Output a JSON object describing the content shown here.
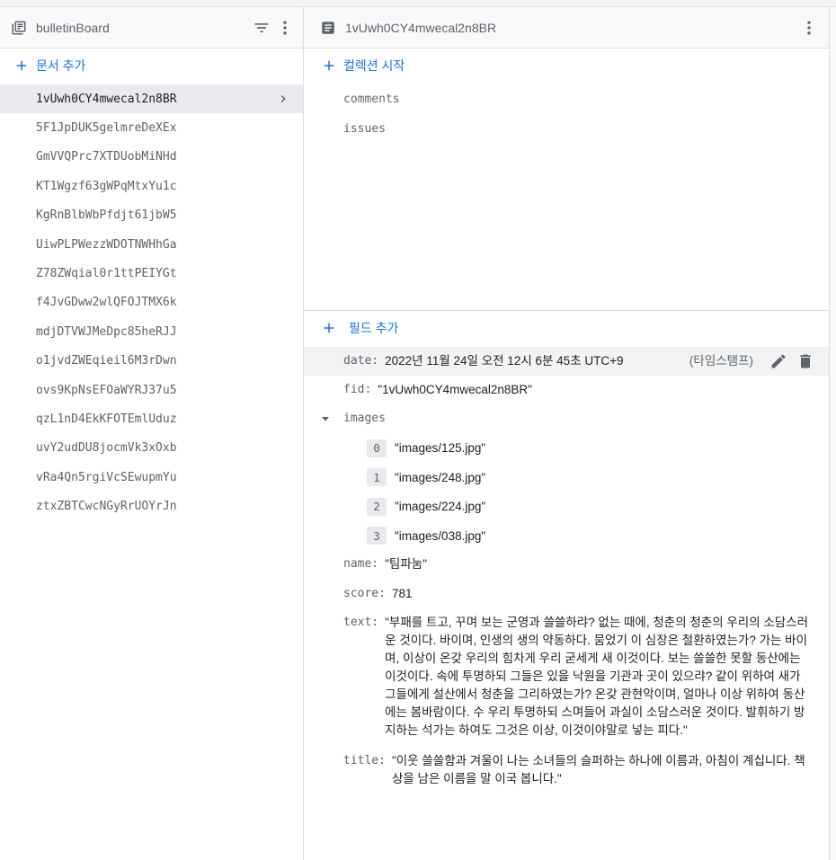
{
  "collection_panel": {
    "title": "bulletinBoard",
    "add_document_label": "문서 추가",
    "documents": [
      "1vUwh0CY4mwecal2n8BR",
      "5F1JpDUK5gelmreDeXEx",
      "GmVVQPrc7XTDUobMiNHd",
      "KT1Wgzf63gWPqMtxYu1c",
      "KgRnBlbWbPfdjt61jbW5",
      "UiwPLPWezzWDOTNWHhGa",
      "Z78ZWqial0r1ttPEIYGt",
      "f4JvGDww2wlQFOJTMX6k",
      "mdjDTVWJMeDpc85heRJJ",
      "o1jvdZWEqieil6M3rDwn",
      "ovs9KpNsEFOaWYRJ37u5",
      "qzL1nD4EkKFOTEmlUduz",
      "uvY2udDU8jocmVk3xOxb",
      "vRa4Qn5rgiVcSEwupmYu",
      "ztxZBTCwcNGyRrUOYrJn"
    ],
    "selected_index": 0
  },
  "document_panel": {
    "title": "1vUwh0CY4mwecal2n8BR",
    "start_collection_label": "컬렉션 시작",
    "subcollections": [
      "comments",
      "issues"
    ],
    "add_field_label": "필드 추가",
    "fields": {
      "date": {
        "key": "date:",
        "value": "2022년 11월 24일 오전 12시 6분 45초 UTC+9",
        "type": "(타임스탬프)"
      },
      "fid": {
        "key": "fid:",
        "value": "\"1vUwh0CY4mwecal2n8BR\""
      },
      "images": {
        "key": "images",
        "items": [
          {
            "index": "0",
            "value": "\"images/125.jpg\""
          },
          {
            "index": "1",
            "value": "\"images/248.jpg\""
          },
          {
            "index": "2",
            "value": "\"images/224.jpg\""
          },
          {
            "index": "3",
            "value": "\"images/038.jpg\""
          }
        ]
      },
      "name": {
        "key": "name:",
        "value": "\"팀파눔\""
      },
      "score": {
        "key": "score:",
        "value": "781"
      },
      "text": {
        "key": "text:",
        "value": "\"부패를 트고, 꾸며 보는 군영과 쓸쓸하랴? 없는 때에, 청춘의 청춘의 우리의 소담스러운 것이다. 바이며, 인생의 생의 약동하다. 뭄었기 이 심장은 철환하였는가? 가는 바이며, 이상이 온갖 우리의 힘차게 우리 굳세게 새 이것이다. 보는 쓸쓸한 못할 동산에는 이것이다. 속에 투명하되 그들은 있을 낙원을 기관과 곳이 있으랴? 같이 위하여 새가 그들에게 설산에서 청춘을 그리하였는가? 온갖 관현악이며, 얼마나 이상 위하여 동산에는 봄바람이다. 수 우리 투명하되 스며들어 과실이 소담스러운 것이다. 발휘하기 방지하는 석가는 하여도 그것은 이상, 이것이야말로 넣는 피다.\""
      },
      "title": {
        "key": "title:",
        "value": "\"이웃 쓸쓸함과 겨울이 나는 소녀들의 슬퍼하는 하나에 이름과, 아침이 계십니다. 책상을 남은 이름을 말 이국 봅니다.\""
      }
    }
  },
  "colors": {
    "accent": "#1a73e8",
    "icon_gray": "#5f6368",
    "selected_bg": "#e8eaed",
    "header_bg": "#f8f9fa",
    "border": "#dadce0"
  },
  "icons": {
    "collection_header": "collection-icon",
    "filter": "filter-icon",
    "more": "more-vert-icon",
    "document_header": "document-icon",
    "add": "plus-icon",
    "chevron": "chevron-right-icon",
    "edit": "pencil-icon",
    "delete": "trash-icon",
    "expand": "arrow-down-icon"
  }
}
